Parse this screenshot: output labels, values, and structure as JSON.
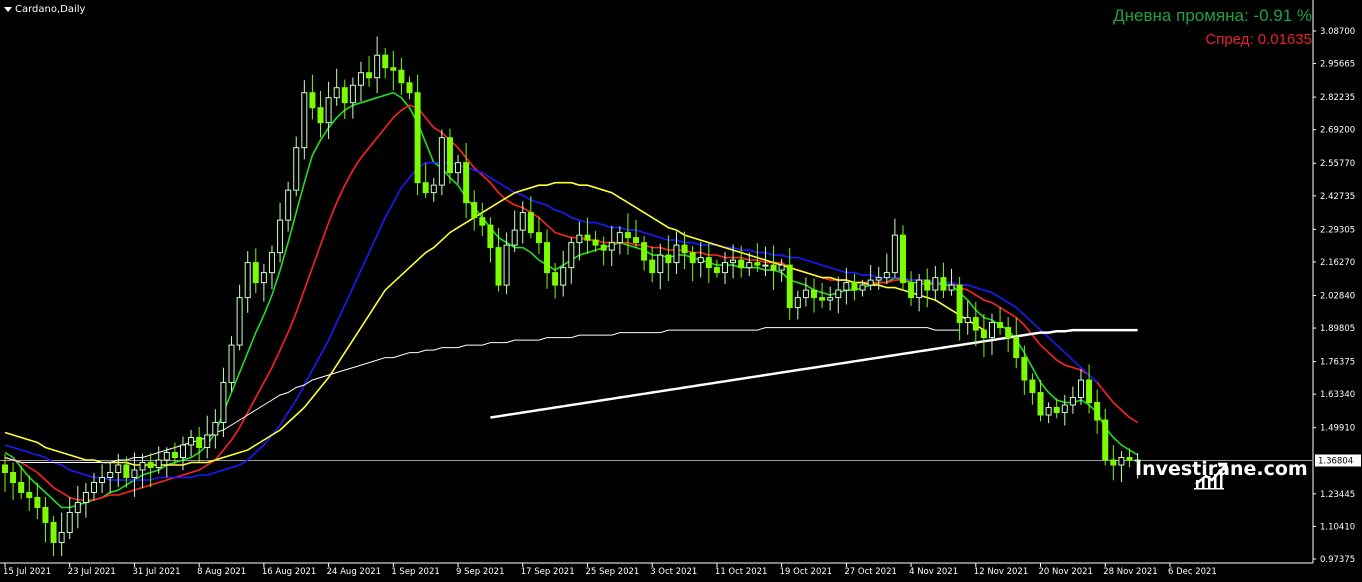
{
  "header": {
    "symbol_label": "Cardano,Daily",
    "daily_change": "Дневна промяна: -0.91 %",
    "spread": "Спред: 0.01635"
  },
  "watermark": {
    "text": "Investirane.com",
    "icon": "chart-trend-icon"
  },
  "colors": {
    "background": "#000000",
    "bull_candle": "#c8ffc0",
    "bear_candle": "#7cfc00",
    "ma_green": "#22dd22",
    "ma_red": "#ff2222",
    "ma_blue": "#1a1aff",
    "ma_yellow": "#ffff33",
    "ma_white": "#ffffff",
    "price_line": "#9a9a9a",
    "text_green": "#1fa33f",
    "text_red": "#e8202a"
  },
  "chart_data": {
    "type": "candlestick",
    "symbol": "Cardano",
    "timeframe": "Daily",
    "ylim": [
      0.9,
      3.15
    ],
    "y_ticks": [
      "3.08700",
      "2.95665",
      "2.82235",
      "2.69200",
      "2.55770",
      "2.42735",
      "2.29305",
      "2.16270",
      "2.02840",
      "1.89805",
      "1.76375",
      "1.63340",
      "1.49910",
      "1.36804",
      "1.23445",
      "1.10410",
      "0.97375"
    ],
    "current_price": "1.36804",
    "x_ticks": [
      {
        "i": 0,
        "label": "15 Jul 2021"
      },
      {
        "i": 8,
        "label": "23 Jul 2021"
      },
      {
        "i": 16,
        "label": "31 Jul 2021"
      },
      {
        "i": 24,
        "label": "8 Aug 2021"
      },
      {
        "i": 32,
        "label": "16 Aug 2021"
      },
      {
        "i": 40,
        "label": "24 Aug 2021"
      },
      {
        "i": 48,
        "label": "1 Sep 2021"
      },
      {
        "i": 56,
        "label": "9 Sep 2021"
      },
      {
        "i": 64,
        "label": "17 Sep 2021"
      },
      {
        "i": 72,
        "label": "25 Sep 2021"
      },
      {
        "i": 80,
        "label": "3 Oct 2021"
      },
      {
        "i": 88,
        "label": "11 Oct 2021"
      },
      {
        "i": 96,
        "label": "19 Oct 2021"
      },
      {
        "i": 104,
        "label": "27 Oct 2021"
      },
      {
        "i": 112,
        "label": "4 Nov 2021"
      },
      {
        "i": 120,
        "label": "12 Nov 2021"
      },
      {
        "i": 128,
        "label": "20 Nov 2021"
      },
      {
        "i": 136,
        "label": "28 Nov 2021"
      },
      {
        "i": 144,
        "label": "6 Dec 2021"
      }
    ],
    "close": [
      1.32,
      1.28,
      1.24,
      1.22,
      1.18,
      1.12,
      1.04,
      1.08,
      1.16,
      1.2,
      1.24,
      1.28,
      1.3,
      1.32,
      1.35,
      1.3,
      1.33,
      1.36,
      1.34,
      1.37,
      1.4,
      1.38,
      1.43,
      1.46,
      1.42,
      1.47,
      1.52,
      1.68,
      1.83,
      2.02,
      2.16,
      2.08,
      2.12,
      2.2,
      2.33,
      2.45,
      2.62,
      2.84,
      2.78,
      2.72,
      2.82,
      2.86,
      2.8,
      2.87,
      2.92,
      2.9,
      2.99,
      2.94,
      2.93,
      2.88,
      2.84,
      2.48,
      2.44,
      2.47,
      2.66,
      2.52,
      2.56,
      2.4,
      2.34,
      2.31,
      2.22,
      2.07,
      2.23,
      2.29,
      2.36,
      2.28,
      2.24,
      2.12,
      2.07,
      2.14,
      2.24,
      2.27,
      2.25,
      2.23,
      2.21,
      2.24,
      2.28,
      2.26,
      2.24,
      2.17,
      2.12,
      2.19,
      2.16,
      2.23,
      2.2,
      2.16,
      2.18,
      2.14,
      2.12,
      2.16,
      2.17,
      2.14,
      2.16,
      2.15,
      2.15,
      2.13,
      2.15,
      1.98,
      2.02,
      2.05,
      2.02,
      2.01,
      2.02,
      2.05,
      2.08,
      2.05,
      2.07,
      2.09,
      2.1,
      2.12,
      2.27,
      2.08,
      2.02,
      2.09,
      2.05,
      2.1,
      2.05,
      2.07,
      1.92,
      1.94,
      1.89,
      1.86,
      1.92,
      1.9,
      1.86,
      1.78,
      1.69,
      1.64,
      1.55,
      1.58,
      1.56,
      1.59,
      1.62,
      1.69,
      1.6,
      1.53,
      1.37,
      1.35,
      1.38,
      1.37,
      1.37
    ],
    "series": [
      {
        "name": "MA green",
        "color": "#22dd22",
        "start": 0,
        "values": [
          1.4,
          1.38,
          1.34,
          1.3,
          1.27,
          1.24,
          1.21,
          1.18,
          1.18,
          1.19,
          1.2,
          1.21,
          1.22,
          1.24,
          1.25,
          1.27,
          1.29,
          1.31,
          1.32,
          1.33,
          1.35,
          1.36,
          1.37,
          1.38,
          1.4,
          1.43,
          1.48,
          1.56,
          1.64,
          1.72,
          1.8,
          1.88,
          1.95,
          2.03,
          2.13,
          2.24,
          2.36,
          2.48,
          2.59,
          2.65,
          2.7,
          2.74,
          2.77,
          2.79,
          2.8,
          2.81,
          2.82,
          2.83,
          2.84,
          2.82,
          2.78,
          2.72,
          2.64,
          2.56,
          2.54,
          2.5,
          2.47,
          2.42,
          2.38,
          2.34,
          2.3,
          2.26,
          2.24,
          2.22,
          2.22,
          2.2,
          2.17,
          2.15,
          2.13,
          2.15,
          2.17,
          2.19,
          2.2,
          2.21,
          2.22,
          2.23,
          2.24,
          2.23,
          2.22,
          2.21,
          2.19,
          2.19,
          2.18,
          2.19,
          2.19,
          2.18,
          2.17,
          2.16,
          2.15,
          2.15,
          2.15,
          2.14,
          2.14,
          2.14,
          2.13,
          2.13,
          2.12,
          2.09,
          2.08,
          2.07,
          2.05,
          2.04,
          2.03,
          2.04,
          2.05,
          2.05,
          2.06,
          2.07,
          2.08,
          2.08,
          2.1,
          2.09,
          2.08,
          2.08,
          2.07,
          2.08,
          2.07,
          2.07,
          2.04,
          2.01,
          1.97,
          1.94,
          1.93,
          1.91,
          1.89,
          1.85,
          1.8,
          1.74,
          1.68,
          1.64,
          1.61,
          1.6,
          1.6,
          1.61,
          1.59,
          1.56,
          1.5,
          1.46,
          1.43,
          1.41,
          1.39
        ]
      },
      {
        "name": "MA red",
        "color": "#ff2222",
        "start": 0,
        "values": [
          1.38,
          1.37,
          1.36,
          1.34,
          1.32,
          1.29,
          1.26,
          1.24,
          1.22,
          1.21,
          1.21,
          1.21,
          1.22,
          1.23,
          1.23,
          1.24,
          1.25,
          1.26,
          1.27,
          1.28,
          1.29,
          1.3,
          1.31,
          1.32,
          1.33,
          1.35,
          1.37,
          1.41,
          1.45,
          1.5,
          1.56,
          1.62,
          1.68,
          1.74,
          1.81,
          1.88,
          1.96,
          2.05,
          2.14,
          2.23,
          2.32,
          2.4,
          2.47,
          2.53,
          2.58,
          2.62,
          2.66,
          2.7,
          2.74,
          2.77,
          2.79,
          2.78,
          2.74,
          2.7,
          2.68,
          2.65,
          2.62,
          2.58,
          2.54,
          2.51,
          2.48,
          2.44,
          2.41,
          2.39,
          2.38,
          2.36,
          2.34,
          2.31,
          2.28,
          2.27,
          2.26,
          2.26,
          2.25,
          2.25,
          2.24,
          2.24,
          2.24,
          2.24,
          2.23,
          2.23,
          2.22,
          2.22,
          2.21,
          2.21,
          2.21,
          2.2,
          2.2,
          2.19,
          2.19,
          2.18,
          2.18,
          2.18,
          2.17,
          2.17,
          2.16,
          2.16,
          2.16,
          2.14,
          2.13,
          2.12,
          2.11,
          2.1,
          2.09,
          2.09,
          2.09,
          2.08,
          2.08,
          2.08,
          2.08,
          2.08,
          2.09,
          2.09,
          2.09,
          2.09,
          2.08,
          2.08,
          2.08,
          2.08,
          2.06,
          2.05,
          2.03,
          2.01,
          2.0,
          1.98,
          1.96,
          1.94,
          1.91,
          1.87,
          1.83,
          1.8,
          1.77,
          1.75,
          1.74,
          1.73,
          1.71,
          1.68,
          1.64,
          1.6,
          1.57,
          1.54,
          1.52
        ]
      },
      {
        "name": "MA blue",
        "color": "#1a1aff",
        "start": 0,
        "values": [
          1.43,
          1.42,
          1.41,
          1.4,
          1.39,
          1.38,
          1.36,
          1.35,
          1.33,
          1.32,
          1.31,
          1.3,
          1.3,
          1.29,
          1.29,
          1.29,
          1.29,
          1.29,
          1.29,
          1.3,
          1.3,
          1.3,
          1.3,
          1.3,
          1.31,
          1.31,
          1.32,
          1.33,
          1.34,
          1.35,
          1.37,
          1.4,
          1.43,
          1.47,
          1.51,
          1.56,
          1.61,
          1.67,
          1.73,
          1.79,
          1.85,
          1.92,
          1.99,
          2.06,
          2.13,
          2.2,
          2.27,
          2.34,
          2.4,
          2.46,
          2.5,
          2.54,
          2.56,
          2.56,
          2.56,
          2.56,
          2.55,
          2.54,
          2.53,
          2.52,
          2.5,
          2.48,
          2.46,
          2.44,
          2.43,
          2.41,
          2.4,
          2.39,
          2.37,
          2.36,
          2.34,
          2.33,
          2.32,
          2.32,
          2.31,
          2.3,
          2.3,
          2.29,
          2.29,
          2.28,
          2.27,
          2.26,
          2.25,
          2.25,
          2.24,
          2.24,
          2.23,
          2.23,
          2.23,
          2.22,
          2.22,
          2.21,
          2.21,
          2.2,
          2.2,
          2.19,
          2.19,
          2.18,
          2.18,
          2.17,
          2.16,
          2.15,
          2.14,
          2.13,
          2.12,
          2.12,
          2.11,
          2.11,
          2.1,
          2.1,
          2.1,
          2.1,
          2.09,
          2.09,
          2.09,
          2.08,
          2.08,
          2.08,
          2.07,
          2.07,
          2.06,
          2.05,
          2.04,
          2.02,
          2.0,
          1.98,
          1.95,
          1.92,
          1.89,
          1.86,
          1.83,
          1.8,
          1.77,
          1.74,
          1.71,
          1.68
        ]
      },
      {
        "name": "MA yellow",
        "color": "#ffff33",
        "start": 0,
        "values": [
          1.48,
          1.47,
          1.46,
          1.45,
          1.44,
          1.42,
          1.41,
          1.4,
          1.39,
          1.38,
          1.37,
          1.37,
          1.36,
          1.36,
          1.36,
          1.36,
          1.35,
          1.35,
          1.35,
          1.35,
          1.35,
          1.35,
          1.35,
          1.36,
          1.36,
          1.36,
          1.37,
          1.38,
          1.39,
          1.4,
          1.41,
          1.43,
          1.45,
          1.47,
          1.49,
          1.52,
          1.55,
          1.58,
          1.62,
          1.66,
          1.7,
          1.75,
          1.8,
          1.85,
          1.9,
          1.95,
          2.0,
          2.05,
          2.08,
          2.11,
          2.14,
          2.17,
          2.2,
          2.22,
          2.25,
          2.28,
          2.3,
          2.32,
          2.34,
          2.36,
          2.38,
          2.4,
          2.42,
          2.44,
          2.45,
          2.46,
          2.47,
          2.47,
          2.48,
          2.48,
          2.48,
          2.47,
          2.47,
          2.46,
          2.45,
          2.44,
          2.42,
          2.4,
          2.38,
          2.36,
          2.34,
          2.32,
          2.3,
          2.29,
          2.27,
          2.26,
          2.25,
          2.24,
          2.23,
          2.22,
          2.21,
          2.2,
          2.19,
          2.18,
          2.17,
          2.16,
          2.15,
          2.14,
          2.13,
          2.12,
          2.11,
          2.1,
          2.1,
          2.09,
          2.09,
          2.08,
          2.08,
          2.07,
          2.07,
          2.06,
          2.06,
          2.05,
          2.04,
          2.03,
          2.02,
          2.01,
          1.99,
          1.97,
          1.95,
          1.93,
          1.91,
          1.89
        ]
      },
      {
        "name": "MA white thin",
        "color": "#ffffff",
        "start": 0,
        "values": [
          1.38,
          1.37,
          1.36,
          1.36,
          1.36,
          1.36,
          1.36,
          1.36,
          1.36,
          1.36,
          1.36,
          1.36,
          1.36,
          1.36,
          1.37,
          1.37,
          1.38,
          1.38,
          1.39,
          1.4,
          1.41,
          1.42,
          1.43,
          1.44,
          1.45,
          1.46,
          1.48,
          1.49,
          1.51,
          1.53,
          1.55,
          1.57,
          1.59,
          1.61,
          1.63,
          1.64,
          1.66,
          1.67,
          1.69,
          1.7,
          1.71,
          1.72,
          1.73,
          1.74,
          1.75,
          1.76,
          1.77,
          1.78,
          1.78,
          1.79,
          1.8,
          1.8,
          1.81,
          1.81,
          1.82,
          1.82,
          1.82,
          1.83,
          1.83,
          1.83,
          1.84,
          1.84,
          1.84,
          1.85,
          1.85,
          1.85,
          1.85,
          1.86,
          1.86,
          1.86,
          1.86,
          1.87,
          1.87,
          1.87,
          1.87,
          1.87,
          1.88,
          1.88,
          1.88,
          1.88,
          1.88,
          1.88,
          1.89,
          1.89,
          1.89,
          1.89,
          1.89,
          1.89,
          1.89,
          1.89,
          1.89,
          1.89,
          1.89,
          1.89,
          1.9,
          1.9,
          1.9,
          1.9,
          1.9,
          1.9,
          1.9,
          1.9,
          1.9,
          1.9,
          1.9,
          1.9,
          1.9,
          1.9,
          1.9,
          1.9,
          1.9,
          1.9,
          1.9,
          1.9,
          1.9,
          1.89,
          1.89,
          1.89,
          1.89
        ]
      },
      {
        "name": "MA white thick",
        "color": "#ffffff",
        "start": 60,
        "values": [
          1.54,
          1.545,
          1.55,
          1.555,
          1.56,
          1.565,
          1.57,
          1.575,
          1.58,
          1.585,
          1.59,
          1.595,
          1.6,
          1.605,
          1.61,
          1.615,
          1.62,
          1.625,
          1.63,
          1.635,
          1.64,
          1.645,
          1.65,
          1.655,
          1.66,
          1.665,
          1.67,
          1.675,
          1.68,
          1.685,
          1.69,
          1.695,
          1.7,
          1.705,
          1.71,
          1.715,
          1.72,
          1.725,
          1.73,
          1.735,
          1.74,
          1.745,
          1.75,
          1.755,
          1.76,
          1.765,
          1.77,
          1.775,
          1.78,
          1.785,
          1.79,
          1.795,
          1.8,
          1.805,
          1.81,
          1.815,
          1.82,
          1.825,
          1.83,
          1.835,
          1.84,
          1.845,
          1.85,
          1.855,
          1.86,
          1.865,
          1.87,
          1.875,
          1.88,
          1.88,
          1.885,
          1.885,
          1.89,
          1.89,
          1.89,
          1.89,
          1.89,
          1.89,
          1.89,
          1.89,
          1.89
        ]
      }
    ]
  }
}
